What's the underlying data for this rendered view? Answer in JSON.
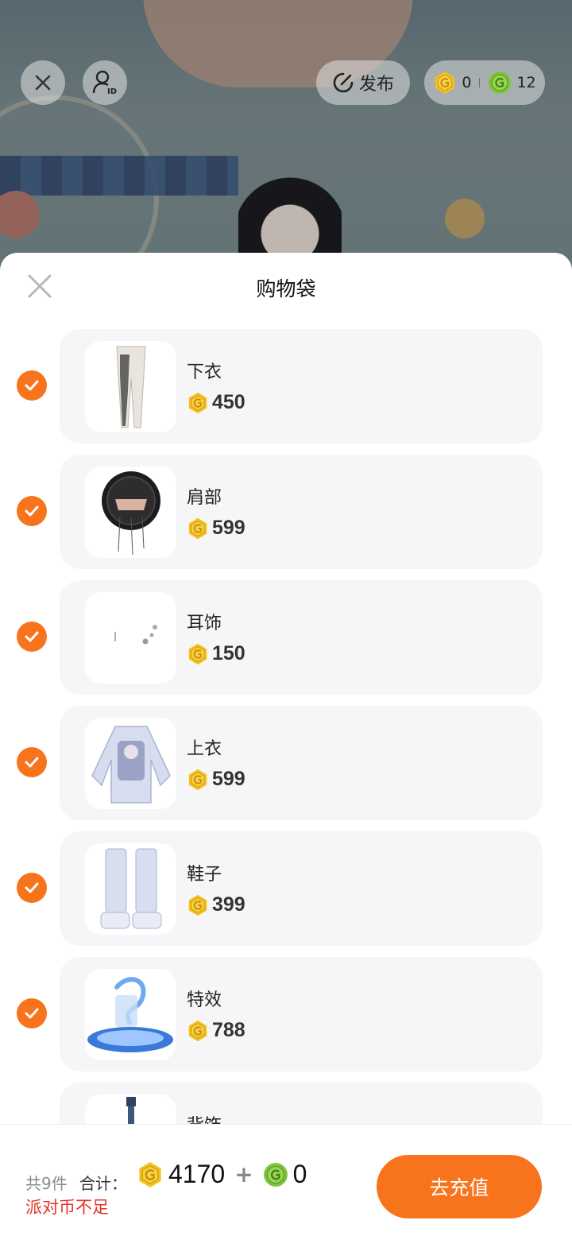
{
  "top_bar": {
    "publish_label": "发布",
    "gold_balance": "0",
    "green_balance": "12"
  },
  "sheet": {
    "title": "购物袋"
  },
  "items": [
    {
      "name": "下衣",
      "price": "450",
      "checked": true
    },
    {
      "name": "肩部",
      "price": "599",
      "checked": true
    },
    {
      "name": "耳饰",
      "price": "150",
      "checked": true
    },
    {
      "name": "上衣",
      "price": "599",
      "checked": true
    },
    {
      "name": "鞋子",
      "price": "399",
      "checked": true
    },
    {
      "name": "特效",
      "price": "788",
      "checked": true
    },
    {
      "name": "背饰",
      "price": "",
      "checked": true
    }
  ],
  "footer": {
    "count_text": "共9件",
    "total_label": "合计：",
    "gold_total": "4170",
    "plus": "+",
    "green_total": "0",
    "warning": "派对币不足",
    "recharge_label": "去充值"
  },
  "colors": {
    "accent": "#f7731c",
    "gold_coin": "#f3c01b",
    "green_coin": "#7cc43a",
    "warning": "#e4322b"
  }
}
